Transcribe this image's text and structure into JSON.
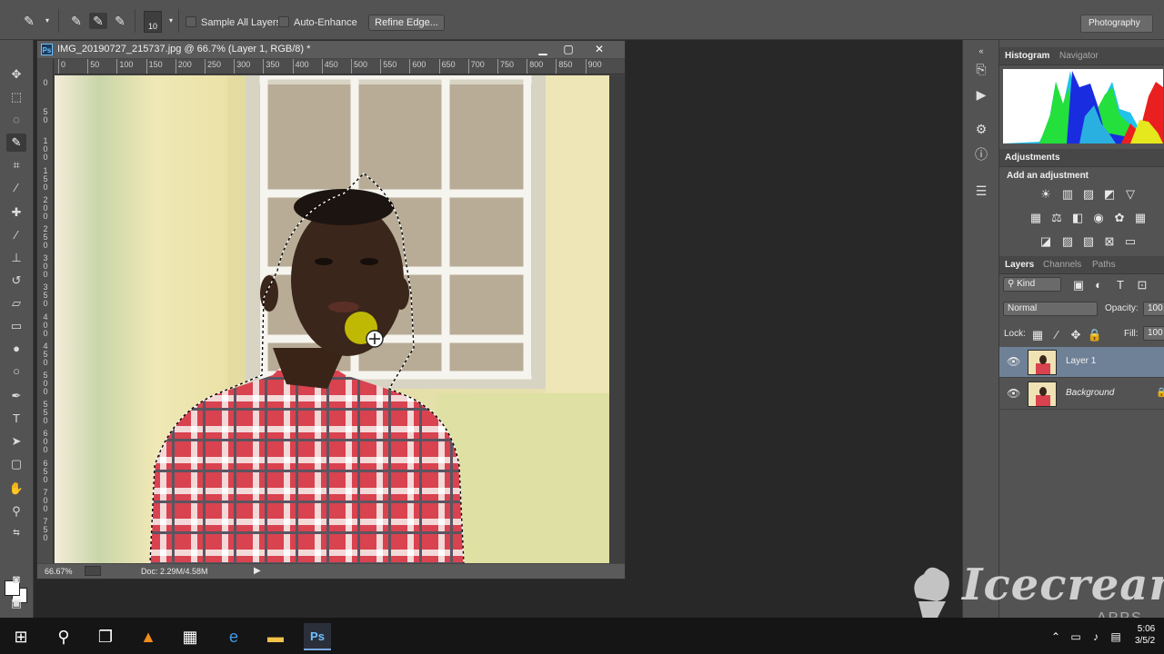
{
  "options_bar": {
    "brush_size": "10",
    "sample_all_layers_label": "Sample All Layers",
    "auto_enhance_label": "Auto-Enhance",
    "refine_edge_label": "Refine Edge...",
    "workspace_label": "Photography"
  },
  "document": {
    "title": "IMG_20190727_215737.jpg @ 66.7% (Layer 1, RGB/8) *",
    "zoom": "66.67%",
    "doc_size": "Doc: 2.29M/4.58M",
    "ruler_top": [
      "0",
      "50",
      "100",
      "150",
      "200",
      "250",
      "300",
      "350",
      "400",
      "450",
      "500",
      "550",
      "600",
      "650",
      "700",
      "750",
      "800",
      "850",
      "900"
    ],
    "ruler_left": [
      "0",
      "5\n0",
      "1\n0\n0",
      "1\n5\n0",
      "2\n0\n0",
      "2\n5\n0",
      "3\n0\n0",
      "3\n5\n0",
      "4\n0\n0",
      "4\n5\n0",
      "5\n0\n0",
      "5\n5\n0",
      "6\n0\n0",
      "6\n5\n0",
      "7\n0\n0",
      "7\n5\n0"
    ]
  },
  "panels": {
    "histogram_tab": "Histogram",
    "navigator_tab": "Navigator",
    "adjustments_tab": "Adjustments",
    "add_adjustment": "Add an adjustment",
    "layers_tab": "Layers",
    "channels_tab": "Channels",
    "paths_tab": "Paths",
    "kind_label": "Kind",
    "blend_mode": "Normal",
    "opacity_label": "Opacity:",
    "opacity_value": "100",
    "lock_label": "Lock:",
    "fill_label": "Fill:",
    "fill_value": "100",
    "layers": [
      {
        "name": "Layer 1",
        "selected": true
      },
      {
        "name": "Background",
        "selected": false
      }
    ]
  },
  "watermark": {
    "text": "Icecream",
    "sub": "APPS"
  },
  "taskbar": {
    "time": "5:06",
    "date": "3/5/2"
  },
  "colors": {
    "accent_selected_layer": "#6f8196",
    "ui_panel": "#535353",
    "background": "#282828"
  }
}
